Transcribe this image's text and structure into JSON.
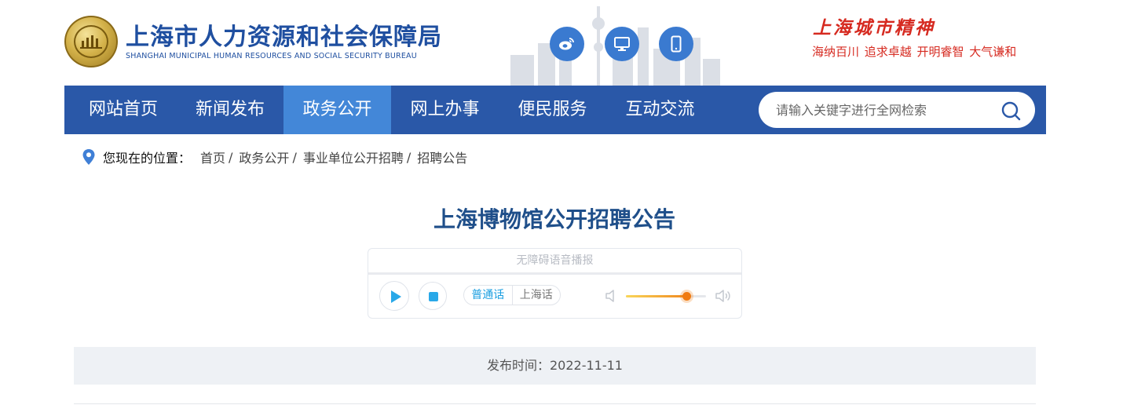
{
  "header": {
    "site_title": "上海市人力资源和社会保障局",
    "site_subtitle": "SHANGHAI MUNICIPAL HUMAN RESOURCES AND SOCIAL SECURITY BUREAU",
    "social_icons": [
      "weibo-icon",
      "desktop-icon",
      "mobile-icon"
    ],
    "slogan_title": "上海城市精神",
    "slogan_sub": "海纳百川  追求卓越  开明睿智  大气谦和"
  },
  "nav": {
    "items": [
      {
        "label": "网站首页",
        "active": false
      },
      {
        "label": "新闻发布",
        "active": false
      },
      {
        "label": "政务公开",
        "active": true
      },
      {
        "label": "网上办事",
        "active": false
      },
      {
        "label": "便民服务",
        "active": false
      },
      {
        "label": "互动交流",
        "active": false
      }
    ],
    "search": {
      "placeholder": "请输入关键字进行全网检索",
      "value": ""
    }
  },
  "breadcrumb": {
    "label": "您现在的位置：",
    "items": [
      "首页",
      "政务公开",
      "事业单位公开招聘",
      "招聘公告"
    ]
  },
  "article": {
    "title": "上海博物馆公开招聘公告",
    "publish_date": "发布时间：2022-11-11"
  },
  "player": {
    "title": "无障碍语音播报",
    "lang_options": [
      "普通话",
      "上海话"
    ],
    "selected_lang": "普通话",
    "volume_percent": 75
  },
  "colors": {
    "nav_bg": "#2a58a8",
    "nav_active": "#4387d8",
    "title_blue": "#1f4f8a",
    "slogan_red": "#d62a20",
    "player_accent": "#29a8e8"
  }
}
